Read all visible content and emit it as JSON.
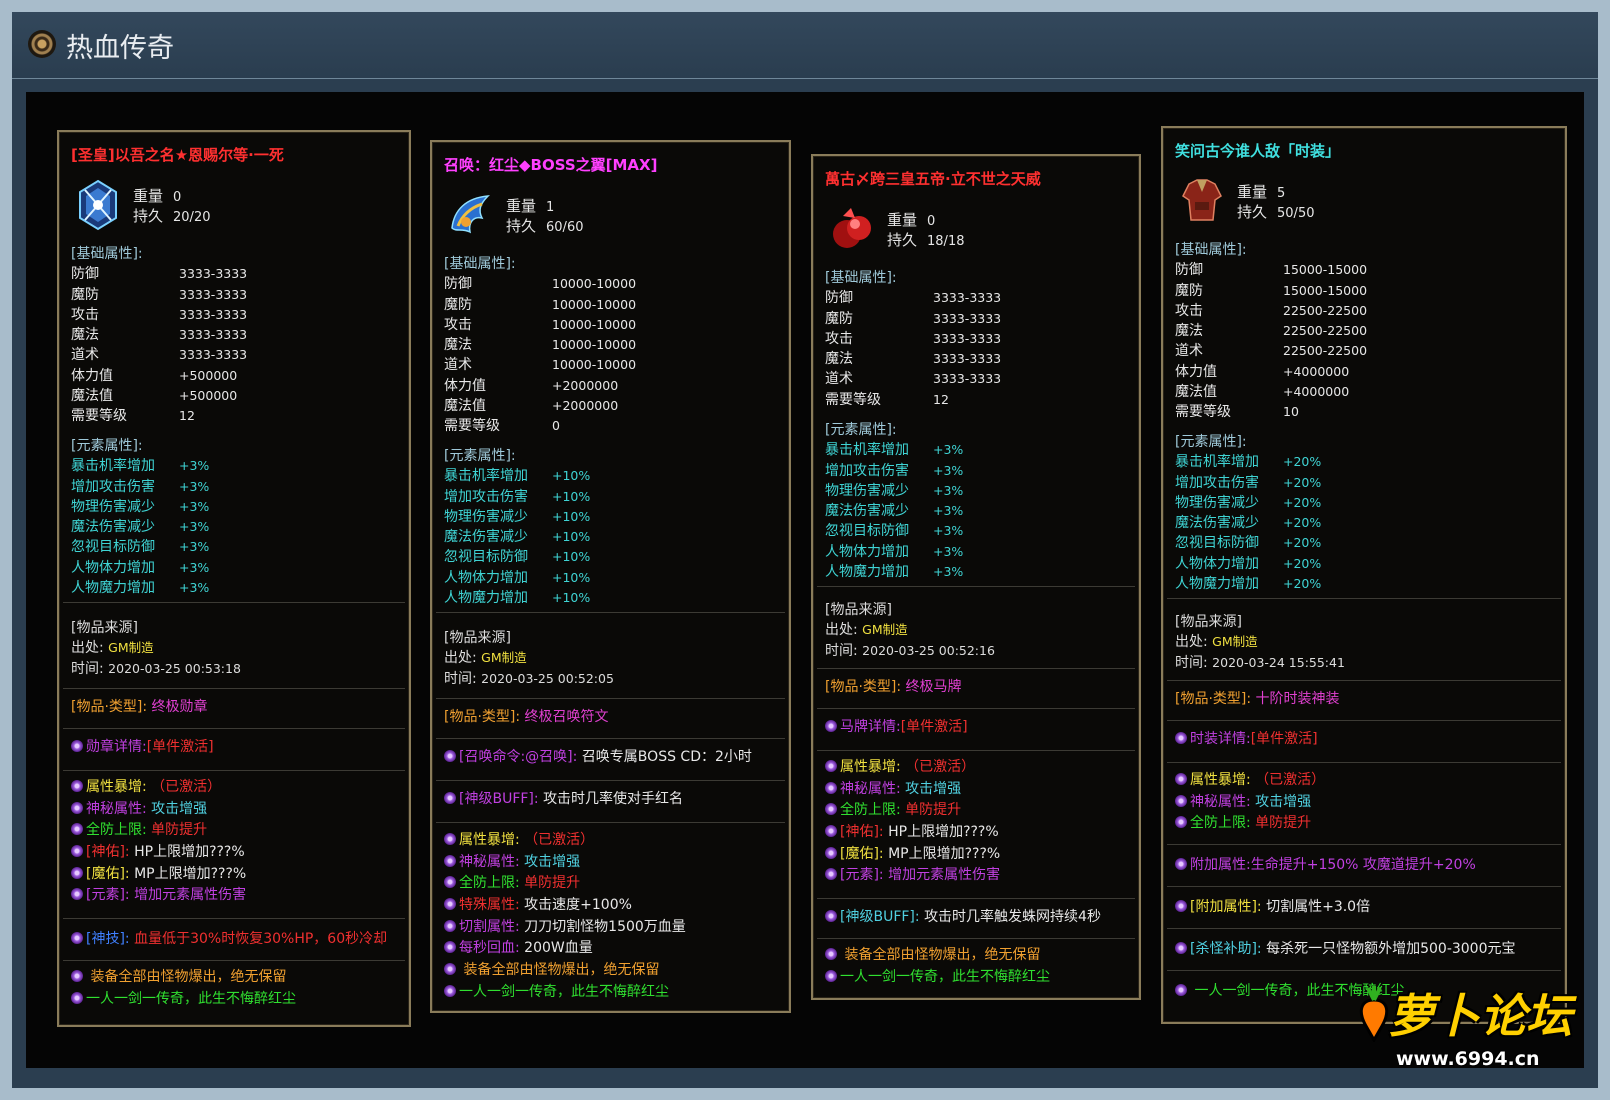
{
  "window": {
    "title": "热血传奇"
  },
  "labels": {
    "weight": "重量",
    "durability": "持久",
    "base_header": "[基础属性]:",
    "element_header": "[元素属性]:",
    "source_header": "[物品来源]",
    "origin_label": "出处:",
    "time_label": "时间:",
    "type_label": "[物品·类型]:"
  },
  "cards": [
    {
      "title": "[圣皇]以吾之名★恩赐尔等·一死",
      "title_color": "#ff3030",
      "weight": "0",
      "durability": "20/20",
      "base": [
        {
          "k": "防御",
          "v": "3333-3333"
        },
        {
          "k": "魔防",
          "v": "3333-3333"
        },
        {
          "k": "攻击",
          "v": "3333-3333"
        },
        {
          "k": "魔法",
          "v": "3333-3333"
        },
        {
          "k": "道术",
          "v": "3333-3333"
        },
        {
          "k": "体力值",
          "v": "+500000"
        },
        {
          "k": "魔法值",
          "v": "+500000"
        },
        {
          "k": "需要等级",
          "v": "12"
        }
      ],
      "elements": [
        {
          "k": "暴击机率增加",
          "v": "+3%"
        },
        {
          "k": "增加攻击伤害",
          "v": "+3%"
        },
        {
          "k": "物理伤害减少",
          "v": "+3%"
        },
        {
          "k": "魔法伤害减少",
          "v": "+3%"
        },
        {
          "k": "忽视目标防御",
          "v": "+3%"
        },
        {
          "k": "人物体力增加",
          "v": "+3%"
        },
        {
          "k": "人物魔力增加",
          "v": "+3%"
        }
      ],
      "origin": "GM制造",
      "time": "2020-03-25 00:53:18",
      "type_value": "终极勋章",
      "detail": {
        "label": "勋章详情:",
        "value": "[单件激活]"
      },
      "effects": [
        {
          "a": "属性暴增:",
          "b": "（已激活）"
        },
        {
          "a": "神秘属性:",
          "b": "攻击增强"
        },
        {
          "a": "全防上限:",
          "b": "单防提升"
        },
        {
          "a": "[神佑]:",
          "b": "HP上限增加???%"
        },
        {
          "a": "[魔佑]:",
          "b": "MP上限增加???%"
        },
        {
          "a": "[元素]:",
          "b": "增加元素属性伤害"
        }
      ],
      "skill": {
        "a": "[神技]:",
        "b": "血量低于30%时恢复30%HP，60秒冷却"
      },
      "flavor": [
        "装备全部由怪物爆出，绝无保留",
        "一人一剑一传奇，此生不悔醉红尘"
      ]
    },
    {
      "title": "召唤：红尘◆BOSS之翼[MAX]",
      "title_color": "#ff40ff",
      "weight": "1",
      "durability": "60/60",
      "base": [
        {
          "k": "防御",
          "v": "10000-10000"
        },
        {
          "k": "魔防",
          "v": "10000-10000"
        },
        {
          "k": "攻击",
          "v": "10000-10000"
        },
        {
          "k": "魔法",
          "v": "10000-10000"
        },
        {
          "k": "道术",
          "v": "10000-10000"
        },
        {
          "k": "体力值",
          "v": "+2000000"
        },
        {
          "k": "魔法值",
          "v": "+2000000"
        },
        {
          "k": "需要等级",
          "v": "0"
        }
      ],
      "elements": [
        {
          "k": "暴击机率增加",
          "v": "+10%"
        },
        {
          "k": "增加攻击伤害",
          "v": "+10%"
        },
        {
          "k": "物理伤害减少",
          "v": "+10%"
        },
        {
          "k": "魔法伤害减少",
          "v": "+10%"
        },
        {
          "k": "忽视目标防御",
          "v": "+10%"
        },
        {
          "k": "人物体力增加",
          "v": "+10%"
        },
        {
          "k": "人物魔力增加",
          "v": "+10%"
        }
      ],
      "origin": "GM制造",
      "time": "2020-03-25 00:52:05",
      "type_value": "终极召唤符文",
      "summon": {
        "a": "[召唤命令:@召唤]:",
        "b": "召唤专属BOSS CD：2小时"
      },
      "buff": {
        "a": "[神级BUFF]:",
        "b": "攻击时几率使对手红名"
      },
      "effects": [
        {
          "a": "属性暴增:",
          "b": "（已激活）"
        },
        {
          "a": "神秘属性:",
          "b": "攻击增强"
        },
        {
          "a": "全防上限:",
          "b": "单防提升"
        },
        {
          "a": "特殊属性:",
          "b": "攻击速度+100%"
        },
        {
          "a": "切割属性:",
          "b": "刀刀切割怪物1500万血量"
        },
        {
          "a": "每秒回血:",
          "b": "200W血量"
        }
      ],
      "flavor": [
        "装备全部由怪物爆出，绝无保留",
        "一人一剑一传奇，此生不悔醉红尘"
      ]
    },
    {
      "title": "萬古〆跨三皇五帝·立不世之天威",
      "title_color": "#ff3030",
      "weight": "0",
      "durability": "18/18",
      "base": [
        {
          "k": "防御",
          "v": "3333-3333"
        },
        {
          "k": "魔防",
          "v": "3333-3333"
        },
        {
          "k": "攻击",
          "v": "3333-3333"
        },
        {
          "k": "魔法",
          "v": "3333-3333"
        },
        {
          "k": "道术",
          "v": "3333-3333"
        },
        {
          "k": "需要等级",
          "v": "12"
        }
      ],
      "elements": [
        {
          "k": "暴击机率增加",
          "v": "+3%"
        },
        {
          "k": "增加攻击伤害",
          "v": "+3%"
        },
        {
          "k": "物理伤害减少",
          "v": "+3%"
        },
        {
          "k": "魔法伤害减少",
          "v": "+3%"
        },
        {
          "k": "忽视目标防御",
          "v": "+3%"
        },
        {
          "k": "人物体力增加",
          "v": "+3%"
        },
        {
          "k": "人物魔力增加",
          "v": "+3%"
        }
      ],
      "origin": "GM制造",
      "time": "2020-03-25 00:52:16",
      "type_value": "终极马牌",
      "detail": {
        "label": "马牌详情:",
        "value": "[单件激活]"
      },
      "effects": [
        {
          "a": "属性暴增:",
          "b": "（已激活）"
        },
        {
          "a": "神秘属性:",
          "b": "攻击增强"
        },
        {
          "a": "全防上限:",
          "b": "单防提升"
        },
        {
          "a": "[神佑]:",
          "b": "HP上限增加???%"
        },
        {
          "a": "[魔佑]:",
          "b": "MP上限增加???%"
        },
        {
          "a": "[元素]:",
          "b": "增加元素属性伤害"
        }
      ],
      "buff": {
        "a": "[神级BUFF]:",
        "b": "攻击时几率触发蛛网持续4秒"
      },
      "flavor": [
        "装备全部由怪物爆出，绝无保留",
        "一人一剑一传奇，此生不悔醉红尘"
      ]
    },
    {
      "title": "笑问古今谁人敌「时装」",
      "title_color": "#40e0e0",
      "weight": "5",
      "durability": "50/50",
      "base": [
        {
          "k": "防御",
          "v": "15000-15000"
        },
        {
          "k": "魔防",
          "v": "15000-15000"
        },
        {
          "k": "攻击",
          "v": "22500-22500"
        },
        {
          "k": "魔法",
          "v": "22500-22500"
        },
        {
          "k": "道术",
          "v": "22500-22500"
        },
        {
          "k": "体力值",
          "v": "+4000000"
        },
        {
          "k": "魔法值",
          "v": "+4000000"
        },
        {
          "k": "需要等级",
          "v": "10"
        }
      ],
      "elements": [
        {
          "k": "暴击机率增加",
          "v": "+20%"
        },
        {
          "k": "增加攻击伤害",
          "v": "+20%"
        },
        {
          "k": "物理伤害减少",
          "v": "+20%"
        },
        {
          "k": "魔法伤害减少",
          "v": "+20%"
        },
        {
          "k": "忽视目标防御",
          "v": "+20%"
        },
        {
          "k": "人物体力增加",
          "v": "+20%"
        },
        {
          "k": "人物魔力增加",
          "v": "+20%"
        }
      ],
      "origin": "GM制造",
      "time": "2020-03-24 15:55:41",
      "type_value": "十阶时装神装",
      "detail": {
        "label": "时装详情:",
        "value": "[单件激活]"
      },
      "effects": [
        {
          "a": "属性暴增:",
          "b": "（已激活）"
        },
        {
          "a": "神秘属性:",
          "b": "攻击增强"
        },
        {
          "a": "全防上限:",
          "b": "单防提升"
        }
      ],
      "extra": {
        "a": "附加属性:",
        "b": "生命提升+150% 攻魔道提升+20%"
      },
      "cut": {
        "a": "[附加属性]:",
        "b": "切割属性+3.0倍"
      },
      "kill": {
        "a": "[杀怪补助]:",
        "b": "每杀死一只怪物额外增加500-3000元宝"
      },
      "flavor": [
        "一人一剑一传奇，此生不悔醉红尘"
      ]
    }
  ],
  "watermark": {
    "text": "萝卜论坛",
    "url": "www.6994.cn"
  }
}
